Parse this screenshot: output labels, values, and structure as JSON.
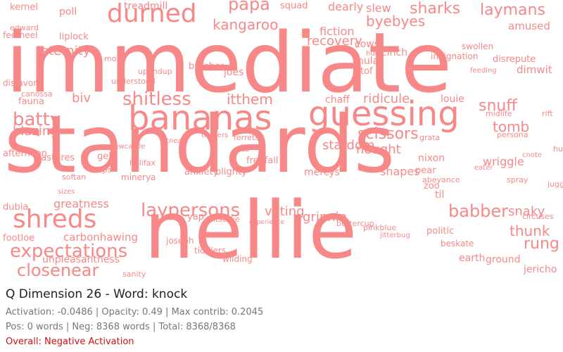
{
  "colors": {
    "word": "#f88888",
    "negative": "#d11111",
    "text": "#222222",
    "muted": "#777777"
  },
  "cloud": {
    "words": [
      {
        "t": "immediate",
        "s": 118
      },
      {
        "t": "standards",
        "s": 112
      },
      {
        "t": "nellie",
        "s": 112
      },
      {
        "t": "bananas",
        "s": 48
      },
      {
        "t": "guessing",
        "s": 48
      },
      {
        "t": "durned",
        "s": 36
      },
      {
        "t": "shreds",
        "s": 36
      },
      {
        "t": "expectations",
        "s": 26
      },
      {
        "t": "laypersons",
        "s": 26
      },
      {
        "t": "shitless",
        "s": 26
      },
      {
        "t": "papa",
        "s": 24
      },
      {
        "t": "sharks",
        "s": 22
      },
      {
        "t": "laymans",
        "s": 22
      },
      {
        "t": "babber",
        "s": 24
      },
      {
        "t": "closenear",
        "s": 24
      },
      {
        "t": "batty",
        "s": 26
      },
      {
        "t": "scissors",
        "s": 22
      },
      {
        "t": "kangaroo",
        "s": 20
      },
      {
        "t": "byebyes",
        "s": 20
      },
      {
        "t": "snuff",
        "s": 22
      },
      {
        "t": "itthem",
        "s": 20
      },
      {
        "t": "tomb",
        "s": 20
      },
      {
        "t": "rung",
        "s": 22
      },
      {
        "t": "thunk",
        "s": 20
      },
      {
        "t": "snaky",
        "s": 18
      },
      {
        "t": "ridicule",
        "s": 18
      },
      {
        "t": "recovery",
        "s": 18
      },
      {
        "t": "eternity",
        "s": 18
      },
      {
        "t": "biv",
        "s": 18
      },
      {
        "t": "blazing",
        "s": 18
      },
      {
        "t": "greatness",
        "s": 16
      },
      {
        "t": "carbonhawing",
        "s": 15
      },
      {
        "t": "unpleasantness",
        "s": 14
      },
      {
        "t": "fiction",
        "s": 16
      },
      {
        "t": "amused",
        "s": 15
      },
      {
        "t": "dimwit",
        "s": 15
      },
      {
        "t": "treadmill",
        "s": 14
      },
      {
        "t": "kernel",
        "s": 13
      },
      {
        "t": "poll",
        "s": 14
      },
      {
        "t": "squad",
        "s": 13
      },
      {
        "t": "dearly",
        "s": 16
      },
      {
        "t": "slew",
        "s": 16
      },
      {
        "t": "cows",
        "s": 14
      },
      {
        "t": "cinch",
        "s": 14
      },
      {
        "t": "hula",
        "s": 14
      },
      {
        "t": "atof",
        "s": 13
      },
      {
        "t": "joes",
        "s": 14
      },
      {
        "t": "butcher",
        "s": 13
      },
      {
        "t": "louie",
        "s": 14
      },
      {
        "t": "chaff",
        "s": 14
      },
      {
        "t": "stardom",
        "s": 18
      },
      {
        "t": "nought",
        "s": 18
      },
      {
        "t": "voting",
        "s": 18
      },
      {
        "t": "grinnin",
        "s": 18
      },
      {
        "t": "shapes",
        "s": 16
      },
      {
        "t": "mercys",
        "s": 14
      },
      {
        "t": "nixon",
        "s": 14
      },
      {
        "t": "pear",
        "s": 13
      },
      {
        "t": "zoo",
        "s": 13
      },
      {
        "t": "til",
        "s": 14
      },
      {
        "t": "wriggle",
        "s": 16
      },
      {
        "t": "jericho",
        "s": 14
      },
      {
        "t": "earth",
        "s": 14
      },
      {
        "t": "ground",
        "s": 14
      },
      {
        "t": "pastures",
        "s": 13
      },
      {
        "t": "fauna",
        "s": 13
      },
      {
        "t": "dubia",
        "s": 13
      },
      {
        "t": "sanity",
        "s": 11
      },
      {
        "t": "footloe",
        "s": 13
      },
      {
        "t": "anxiety",
        "s": 13
      },
      {
        "t": "blighty",
        "s": 13
      },
      {
        "t": "freefall",
        "s": 13
      },
      {
        "t": "ferrets",
        "s": 11
      },
      {
        "t": "ts",
        "s": 14
      },
      {
        "t": "hitstrike",
        "s": 11
      },
      {
        "t": "yap",
        "s": 13
      },
      {
        "t": "gel",
        "s": 13
      },
      {
        "t": "flops",
        "s": 11
      },
      {
        "t": "halifax",
        "s": 11
      },
      {
        "t": "minerya",
        "s": 12
      },
      {
        "t": "joseph",
        "s": 12
      },
      {
        "t": "tiddlers",
        "s": 12
      },
      {
        "t": "wilding",
        "s": 12
      },
      {
        "t": "buttercup",
        "s": 11
      },
      {
        "t": "pinkblue",
        "s": 11
      },
      {
        "t": "jitterbug",
        "s": 10
      },
      {
        "t": "politic",
        "s": 13
      },
      {
        "t": "beskate",
        "s": 12
      },
      {
        "t": "circuses",
        "s": 11
      },
      {
        "t": "spray",
        "s": 11
      },
      {
        "t": "juggling",
        "s": 11
      },
      {
        "t": "persona",
        "s": 11
      },
      {
        "t": "hubert",
        "s": 11
      },
      {
        "t": "cnote",
        "s": 10
      },
      {
        "t": "eater",
        "s": 10
      },
      {
        "t": "feeding",
        "s": 10
      },
      {
        "t": "swollen",
        "s": 12
      },
      {
        "t": "indignation",
        "s": 12
      },
      {
        "t": "disrepute",
        "s": 13
      },
      {
        "t": "midlife",
        "s": 11
      },
      {
        "t": "rift",
        "s": 11
      },
      {
        "t": "grata",
        "s": 11
      },
      {
        "t": "afternoon",
        "s": 13
      },
      {
        "t": "disfavor",
        "s": 12
      },
      {
        "t": "feetheel",
        "s": 12
      },
      {
        "t": "liplock",
        "s": 13
      },
      {
        "t": "understood",
        "s": 11
      },
      {
        "t": "upandup",
        "s": 11
      },
      {
        "t": "mole",
        "s": 11
      },
      {
        "t": "edward",
        "s": 11
      },
      {
        "t": "canossa",
        "s": 11
      },
      {
        "t": "atneart",
        "s": 10
      },
      {
        "t": "timbers",
        "s": 10
      },
      {
        "t": "newcastle",
        "s": 10
      },
      {
        "t": "softan",
        "s": 11
      },
      {
        "t": "sizes",
        "s": 10
      },
      {
        "t": "abeyance",
        "s": 11
      },
      {
        "t": "experience",
        "s": 9
      },
      {
        "t": "hula",
        "s": 10
      }
    ]
  },
  "panel": {
    "title": "Q Dimension 26 - Word: knock",
    "stats": "Activation: -0.0486 | Opacity: 0.49 | Max contrib: 0.2045",
    "counts": "Pos: 0 words | Neg: 8368 words | Total: 8368/8368",
    "overall": "Overall: Negative Activation"
  }
}
